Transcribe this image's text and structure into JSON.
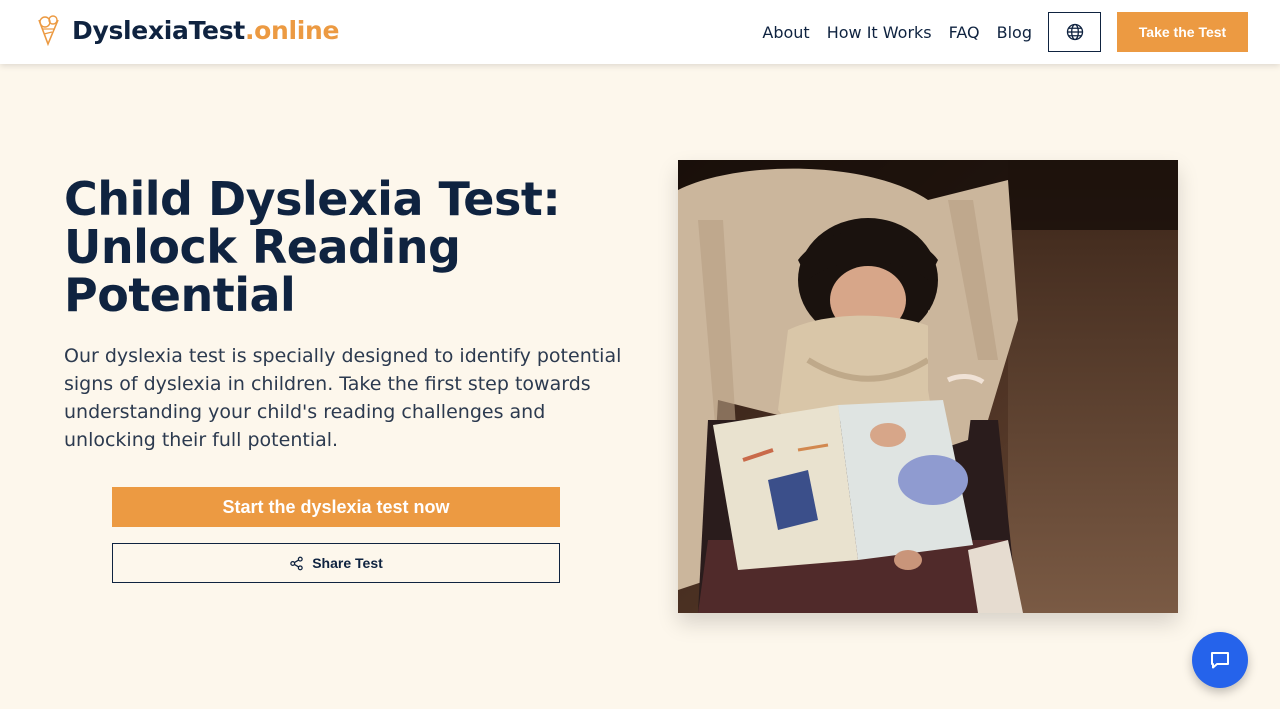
{
  "header": {
    "brand_name": "DyslexiaTest",
    "brand_tld": ".online",
    "nav": [
      {
        "label": "About"
      },
      {
        "label": "How It Works"
      },
      {
        "label": "FAQ"
      },
      {
        "label": "Blog"
      }
    ],
    "language_icon": "globe-icon",
    "cta_label": "Take the Test"
  },
  "hero": {
    "title": "Child Dyslexia Test: Unlock Reading Potential",
    "description": "Our dyslexia test is specially designed to identify potential signs of dyslexia in children. Take the first step towards understanding your child's reading challenges and unlocking their full potential.",
    "start_label": "Start the dyslexia test now",
    "share_label": "Share Test",
    "share_icon": "share-icon"
  },
  "chat": {
    "icon": "chat-bubble-icon"
  },
  "colors": {
    "accent": "#ec9a42",
    "navy": "#0f2340",
    "background": "#fdf7ec",
    "chat": "#2563eb"
  }
}
